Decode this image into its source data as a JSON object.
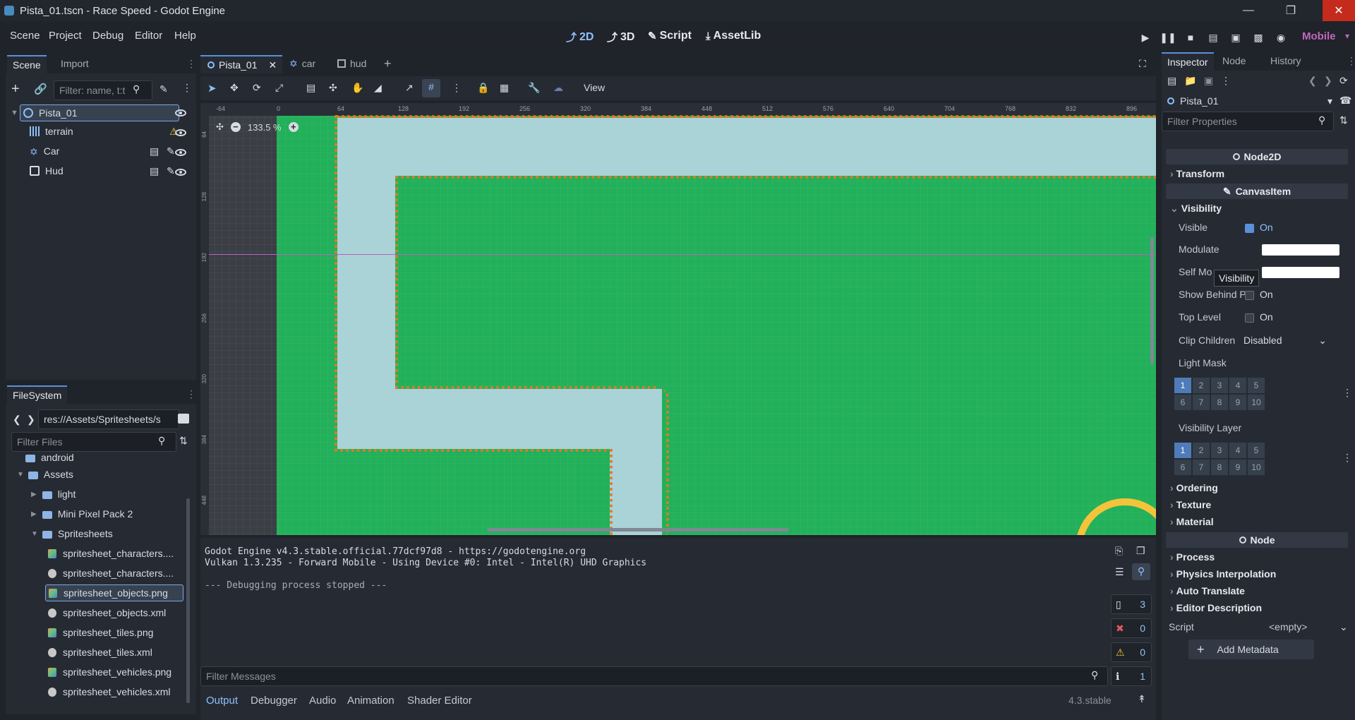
{
  "window": {
    "title": "Pista_01.tscn - Race Speed - Godot Engine",
    "controls": [
      "minimize-icon",
      "restore-icon",
      "close-icon"
    ]
  },
  "menu": [
    "Scene",
    "Project",
    "Debug",
    "Editor",
    "Help"
  ],
  "workspaces": [
    {
      "label": "2D",
      "icon": "2d-icon"
    },
    {
      "label": "3D",
      "icon": "3d-icon"
    },
    {
      "label": "Script",
      "icon": "script-icon"
    },
    {
      "label": "AssetLib",
      "icon": "assetlib-icon"
    }
  ],
  "renderer": "Mobile",
  "scene_dock": {
    "tabs": [
      "Scene",
      "Import"
    ],
    "filter_placeholder": "Filter: name, t:t",
    "nodes": [
      {
        "name": "Pista_01",
        "icon": "node2d-icon",
        "selected": true
      },
      {
        "name": "terrain",
        "icon": "tilemap-icon",
        "warning": true
      },
      {
        "name": "Car",
        "icon": "characterbody-icon",
        "instanced": true
      },
      {
        "name": "Hud",
        "icon": "canvaslayer-icon",
        "instanced": true
      }
    ]
  },
  "filesystem": {
    "title": "FileSystem",
    "path": "res://Assets/Spritesheets/s",
    "filter_placeholder": "Filter Files",
    "items": [
      {
        "label": "android",
        "type": "folder",
        "level": 1
      },
      {
        "label": "Assets",
        "type": "folder",
        "level": 1,
        "expanded": true
      },
      {
        "label": "light",
        "type": "folder",
        "level": 2
      },
      {
        "label": "Mini Pixel Pack 2",
        "type": "folder",
        "level": 2
      },
      {
        "label": "Spritesheets",
        "type": "folder",
        "level": 2,
        "expanded": true
      },
      {
        "label": "spritesheet_characters....",
        "type": "image",
        "level": 3
      },
      {
        "label": "spritesheet_characters....",
        "type": "xml",
        "level": 3
      },
      {
        "label": "spritesheet_objects.png",
        "type": "image",
        "level": 3,
        "selected": true
      },
      {
        "label": "spritesheet_objects.xml",
        "type": "xml",
        "level": 3
      },
      {
        "label": "spritesheet_tiles.png",
        "type": "image",
        "level": 3
      },
      {
        "label": "spritesheet_tiles.xml",
        "type": "xml",
        "level": 3
      },
      {
        "label": "spritesheet_vehicles.png",
        "type": "image",
        "level": 3
      },
      {
        "label": "spritesheet_vehicles.xml",
        "type": "xml",
        "level": 3
      }
    ]
  },
  "editor_tabs": [
    {
      "label": "Pista_01",
      "icon": "node2d-icon",
      "active": true
    },
    {
      "label": "car",
      "icon": "characterbody-icon"
    },
    {
      "label": "hud",
      "icon": "canvaslayer-icon"
    }
  ],
  "viewport_toolbar": {
    "view_label": "View"
  },
  "viewport": {
    "zoom": "133.5 %",
    "ruler_ticks": [
      "-64",
      "0",
      "64",
      "128",
      "192",
      "256",
      "320",
      "384",
      "448",
      "512",
      "576",
      "640",
      "704",
      "768",
      "832",
      "896"
    ],
    "ruler_ticks_v": [
      "64",
      "128",
      "192",
      "256",
      "320",
      "384",
      "448"
    ],
    "colors": {
      "grass": "#22b05a",
      "road": "#a9d3d6",
      "curb": "#e87722",
      "out_of_bounds": "#3b3f45"
    }
  },
  "output": {
    "lines": [
      "Godot Engine v4.3.stable.official.77dcf97d8 - https://godotengine.org",
      "Vulkan 1.3.235 - Forward Mobile - Using Device #0: Intel - Intel(R) UHD Graphics",
      "",
      "--- Debugging process stopped ---"
    ],
    "filter_placeholder": "Filter Messages",
    "counts": {
      "messages": "3",
      "errors": "0",
      "warnings": "0",
      "editor": "1"
    },
    "tabs": [
      "Output",
      "Debugger",
      "Audio",
      "Animation",
      "Shader Editor"
    ],
    "version": "4.3.stable"
  },
  "inspector": {
    "tabs": [
      "Inspector",
      "Node",
      "History"
    ],
    "object": "Pista_01",
    "filter_placeholder": "Filter Properties",
    "header_node2d": "Node2D",
    "transform": "Transform",
    "header_canvasitem": "CanvasItem",
    "visibility": "Visibility",
    "props": {
      "visible": {
        "label": "Visible",
        "value": "On",
        "checked": true
      },
      "modulate": {
        "label": "Modulate",
        "color": "#ffffff"
      },
      "self_modulate": {
        "label": "Self Mo",
        "color": "#ffffff"
      },
      "show_behind": {
        "label": "Show Behind Pa",
        "value": "On",
        "checked": false
      },
      "top_level": {
        "label": "Top Level",
        "value": "On",
        "checked": false
      },
      "clip_children": {
        "label": "Clip Children",
        "value": "Disabled"
      },
      "light_mask": {
        "label": "Light Mask"
      },
      "visibility_layer": {
        "label": "Visibility Layer"
      }
    },
    "layer_cells": [
      "1",
      "2",
      "3",
      "4",
      "5",
      "6",
      "7",
      "8",
      "9",
      "10"
    ],
    "tooltip": "Visibility",
    "categories": [
      "Ordering",
      "Texture",
      "Material"
    ],
    "header_node": "Node",
    "node_categories": [
      "Process",
      "Physics Interpolation",
      "Auto Translate",
      "Editor Description"
    ],
    "script": {
      "label": "Script",
      "value": "<empty>"
    },
    "add_metadata": "Add Metadata"
  }
}
